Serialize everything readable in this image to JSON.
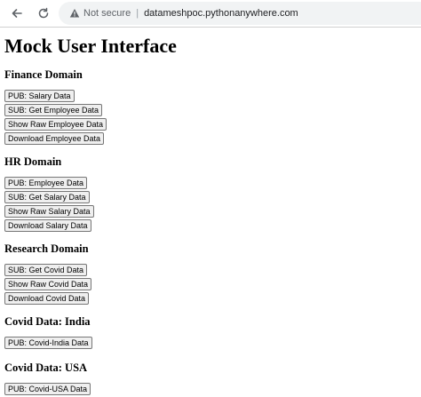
{
  "browser": {
    "not_secure": "Not secure",
    "separator": "|",
    "url": "datameshpoc.pythonanywhere.com"
  },
  "page": {
    "title": "Mock User Interface"
  },
  "sections": {
    "finance": {
      "heading": "Finance Domain",
      "buttons": [
        "PUB: Salary Data",
        "SUB: Get Employee Data",
        "Show Raw Employee Data",
        "Download Employee Data"
      ]
    },
    "hr": {
      "heading": "HR Domain",
      "buttons": [
        "PUB: Employee Data",
        "SUB: Get Salary Data",
        "Show Raw Salary Data",
        "Download Salary Data"
      ]
    },
    "research": {
      "heading": "Research Domain",
      "buttons": [
        "SUB: Get Covid Data",
        "Show Raw Covid Data",
        "Download Covid Data"
      ]
    },
    "covid_india": {
      "heading": "Covid Data: India",
      "buttons": [
        "PUB: Covid-India Data"
      ]
    },
    "covid_usa": {
      "heading": "Covid Data: USA",
      "buttons": [
        "PUB: Covid-USA Data"
      ]
    }
  },
  "icons": {
    "back": "back-arrow-icon",
    "reload": "reload-icon",
    "warning": "warning-icon"
  }
}
